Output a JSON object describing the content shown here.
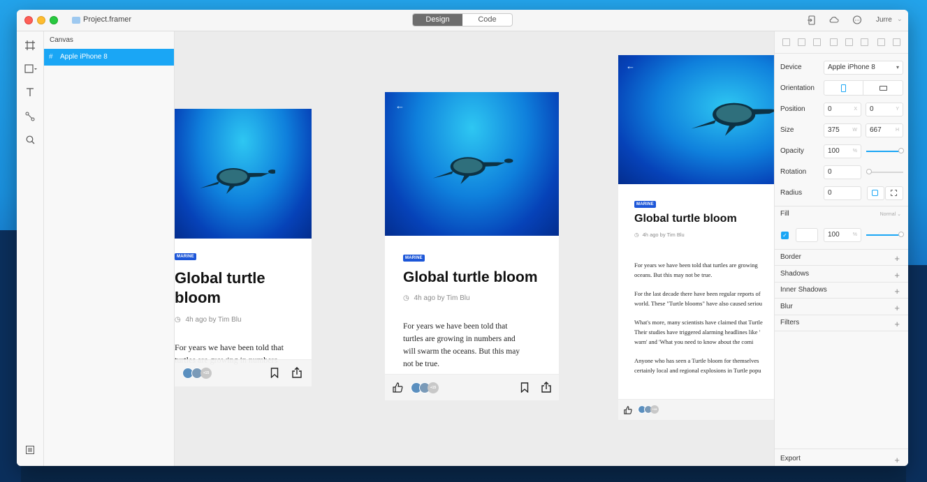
{
  "window": {
    "title": "Project.framer",
    "mode_tabs": [
      "Design",
      "Code"
    ],
    "active_tab": "Design",
    "user": "Jurre"
  },
  "layers": {
    "title": "Canvas",
    "items": [
      {
        "label": "Apple iPhone 8",
        "selected": true
      }
    ]
  },
  "article": {
    "tag": "MARINE",
    "headline": "Global turtle bloom",
    "headline_line1": "Global turtle",
    "headline_line2": "bloom",
    "meta": "4h ago by Tim Blu",
    "avatar_count": "+15",
    "frame1_body": [
      "For years we have been told that",
      "turtles are growing in numbers"
    ],
    "frame2_body": [
      "For years we have been told that",
      "turtles are growing in numbers and",
      "will swarm the oceans. But this may",
      "not be true."
    ],
    "frame3_paragraphs": [
      [
        "For years we have been told that turtles are growing",
        "oceans. But this may not be true."
      ],
      [
        "For the last decade there have been regular reports of",
        "world. These \"Turtle blooms\" have also caused seriou"
      ],
      [
        "What's more, many scientists have claimed that Turtle",
        "Their studies have triggered alarming headlines like '",
        "warn' and 'What you need to know about the comi"
      ],
      [
        "Anyone who has seen a Turtle bloom for themselves",
        "certainly local and regional explosions in Turtle popu"
      ]
    ]
  },
  "inspector": {
    "device_label": "Device",
    "device_value": "Apple iPhone 8",
    "orientation_label": "Orientation",
    "position_label": "Position",
    "position_x": "0",
    "position_y": "0",
    "x_suffix": "X",
    "y_suffix": "Y",
    "size_label": "Size",
    "size_w": "375",
    "size_h": "667",
    "w_suffix": "W",
    "h_suffix": "H",
    "opacity_label": "Opacity",
    "opacity_value": "100",
    "percent": "%",
    "rotation_label": "Rotation",
    "rotation_value": "0",
    "radius_label": "Radius",
    "radius_value": "0",
    "fill_label": "Fill",
    "fill_mode": "Normal",
    "fill_opacity": "100",
    "sections": [
      "Border",
      "Shadows",
      "Inner Shadows",
      "Blur",
      "Filters"
    ],
    "export_label": "Export"
  },
  "colors": {
    "accent": "#1aa6f5",
    "tag_blue": "#1c56d8",
    "close": "#fe5f57",
    "minimize": "#febc2e",
    "maximize": "#28c840"
  },
  "icons": {
    "tools": [
      "frame-tool-icon",
      "shape-tool-icon",
      "text-tool-icon",
      "path-tool-icon",
      "search-icon"
    ],
    "toolbar": [
      "preview-icon",
      "cloud-icon",
      "comment-icon"
    ]
  }
}
